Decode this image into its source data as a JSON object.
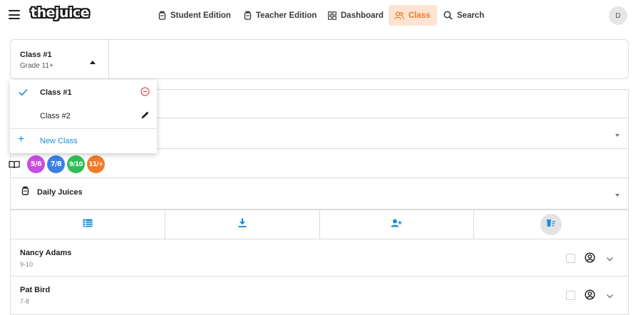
{
  "app": {
    "logo_text": "thejuice",
    "accent": "#f07c28",
    "link_color": "#1a8fd8"
  },
  "nav": {
    "items": [
      {
        "label": "Student Edition",
        "icon": "juice-jar-icon"
      },
      {
        "label": "Teacher Edition",
        "icon": "juice-jar-icon"
      },
      {
        "label": "Dashboard",
        "icon": "dashboard-grid-icon"
      },
      {
        "label": "Class",
        "icon": "people-icon",
        "active": true
      },
      {
        "label": "Search",
        "icon": "search-icon"
      }
    ],
    "avatar_initial": "D"
  },
  "class_selector": {
    "name": "Class #1",
    "grade": "Grade 11+"
  },
  "class_menu": {
    "items": [
      {
        "label": "Class #1",
        "selected": true,
        "action_icon": "remove-circle-icon"
      },
      {
        "label": "Class #2",
        "selected": false,
        "action_icon": "pencil-icon"
      }
    ],
    "new_label": "New Class"
  },
  "grade_levels": [
    {
      "top": "5",
      "bottom": "6",
      "color": "#c84de0"
    },
    {
      "top": "7",
      "bottom": "8",
      "color": "#3b7fe6"
    },
    {
      "top": "9",
      "bottom": "10",
      "color": "#2dbf57"
    },
    {
      "top": "11",
      "bottom": "+",
      "color": "#f07c28"
    }
  ],
  "daily_juices": {
    "label": "Daily Juices"
  },
  "actions": [
    {
      "icon": "table-list-icon"
    },
    {
      "icon": "download-icon"
    },
    {
      "icon": "add-student-icon"
    },
    {
      "icon": "sort-filter-icon"
    }
  ],
  "students": [
    {
      "name": "Nancy Adams",
      "level": "9-10"
    },
    {
      "name": "Pat Bird",
      "level": "7-8"
    }
  ]
}
